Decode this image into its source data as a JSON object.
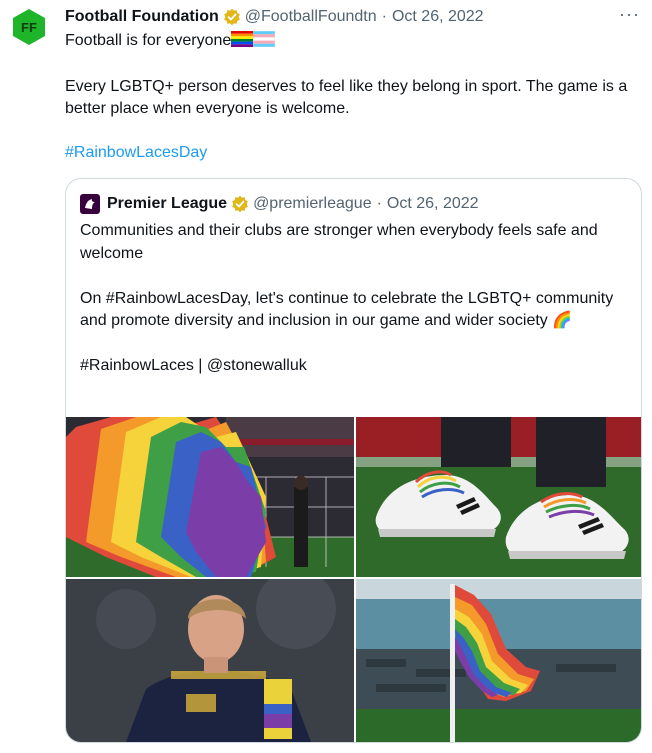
{
  "tweet": {
    "author_name": "Football Foundation",
    "author_handle": "@FootballFoundtn",
    "separator": "·",
    "date": "Oct 26, 2022",
    "more_label": "···",
    "avatar_text": "FF",
    "avatar_color": "#1fb52a",
    "line1": "Football is for everyone",
    "line2": "Every LGBTQ+ person deserves to feel like they belong in sport. The game is a better place when everyone is welcome.",
    "hashtag": "#RainbowLacesDay"
  },
  "quoted": {
    "author_name": "Premier League",
    "author_handle": "@premierleague",
    "separator": "·",
    "date": "Oct 26, 2022",
    "brand_color": "#37003c",
    "line1": "Communities and their clubs are stronger when everybody feels safe and welcome",
    "line2": "On #RainbowLacesDay, let's continue to celebrate the LGBTQ+ community and promote diversity and inclusion in our game and wider society",
    "line2_emoji": "🌈",
    "line3": "#RainbowLaces | @stonewalluk"
  },
  "media": {
    "images": [
      {
        "icon": "rainbow-flag-stadium-photo"
      },
      {
        "icon": "rainbow-laces-shoes-photo"
      },
      {
        "icon": "player-captain-armband-photo"
      },
      {
        "icon": "rainbow-corner-flag-photo"
      }
    ]
  },
  "colors": {
    "link": "#1d9bf0",
    "verified_gold": "#e2b719",
    "secondary_text": "#536471"
  }
}
